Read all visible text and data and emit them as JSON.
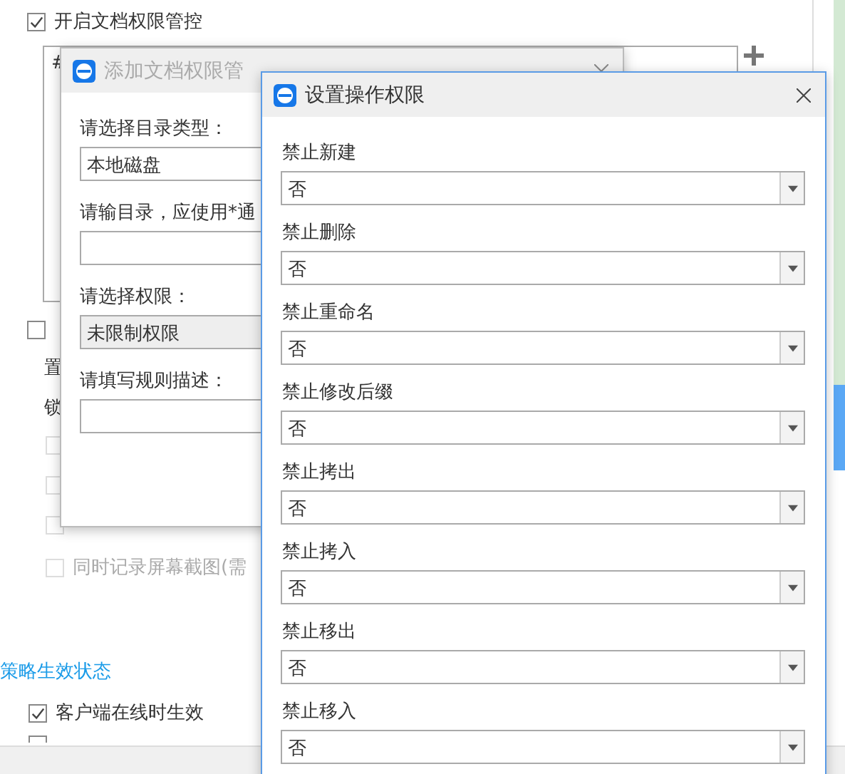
{
  "page": {
    "doc_control": {
      "label": "开启文档权限管控",
      "checked": true
    },
    "rules_table": {
      "header_cell": "#"
    },
    "watermark_option": {
      "checked": false
    },
    "setting_labels": [
      "置",
      "锁"
    ],
    "sub_options": [
      {
        "checked": false,
        "disabled": true
      },
      {
        "checked": false,
        "disabled": true
      },
      {
        "checked": false,
        "disabled": true
      },
      {
        "checked": false,
        "disabled": true,
        "label": "同时记录屏幕截图(需"
      }
    ],
    "status_section": {
      "heading": "策略生效状态",
      "options": [
        {
          "label": "客户端在线时生效",
          "checked": true
        },
        {
          "checked": false
        }
      ]
    }
  },
  "add_rule_dialog": {
    "title": "添加文档权限管",
    "active": false,
    "fields": [
      {
        "label": "请选择目录类型：",
        "value": "本地磁盘",
        "disabled": false
      },
      {
        "label": "请输目录，应使用*通",
        "disabled": false
      },
      {
        "label": "请选择权限：",
        "value": "未限制权限",
        "disabled": true
      },
      {
        "label": "请填写规则描述：",
        "disabled": false
      }
    ]
  },
  "permission_dialog": {
    "title": "设置操作权限",
    "active": true,
    "options": [
      {
        "label": "禁止新建",
        "value": "否"
      },
      {
        "label": "禁止删除",
        "value": "否"
      },
      {
        "label": "禁止重命名",
        "value": "否"
      },
      {
        "label": "禁止修改后缀",
        "value": "否"
      },
      {
        "label": "禁止拷出",
        "value": "否"
      },
      {
        "label": "禁止拷入",
        "value": "否"
      },
      {
        "label": "禁止移出",
        "value": "否"
      },
      {
        "label": "禁止移入",
        "value": "否"
      }
    ]
  }
}
